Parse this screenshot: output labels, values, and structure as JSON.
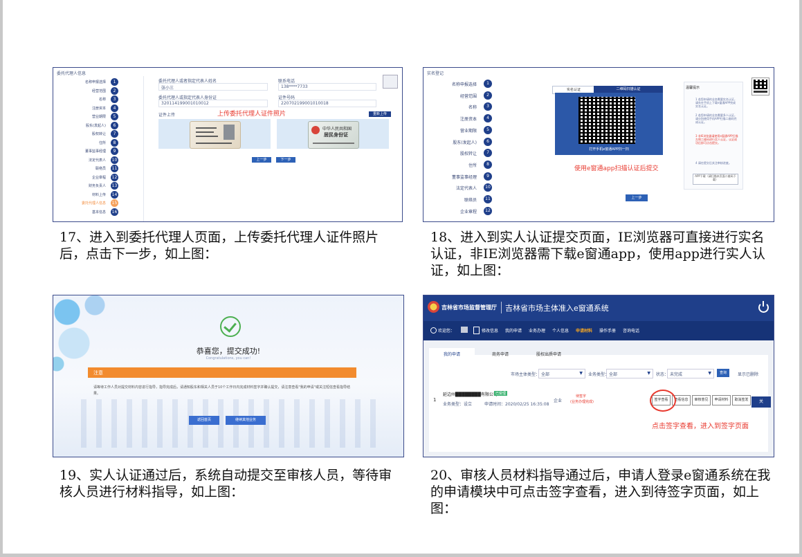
{
  "captions": {
    "c17": "17、进入到委托代理人页面，上传委托代理人证件照片后，点击下一步，如上图：",
    "c18": "18、进入到实人认证提交页面，IE浏览器可直接进行实名认证，非IE浏览器需下载e窗通app，使用app进行实人认证，如上图：",
    "c19": "19、实人认证通过后，系统自动提交至审核人员，等待审核人员进行材料指导，如上图：",
    "c20": "20、审核人员材料指导通过后，申请人登录e窗通系统在我的申请模块中可点击签字查看，进入到待签字页面，如上图："
  },
  "s17": {
    "header": "委托代理人信息",
    "steps": [
      "名称申报选择",
      "经营范围",
      "名称",
      "注册资本",
      "营业期限",
      "股东(发起人)",
      "股权转让",
      "住所",
      "董事监事经理",
      "法定代表人",
      "联络员",
      "企业章程",
      "财务负责人",
      "材料上传",
      "委托代理人信息",
      "基本信息"
    ],
    "step_numbers": [
      "1",
      "2",
      "3",
      "4",
      "5",
      "6",
      "7",
      "8",
      "9",
      "10",
      "11",
      "12",
      "13",
      "14",
      "15",
      "16"
    ],
    "field1_label": "委托代理人或者指定代表人姓名",
    "field1_value": "张小三",
    "field2_label": "委托代理人或指定代表人身份证",
    "field2_value": "320114199001010012",
    "field3_label": "联系电话",
    "field3_value": "138****7733",
    "field4_label": "证件号码",
    "field4_value": "220702199001010018",
    "upload_label": "证件上传",
    "upload_note": "上传委托代理人证件照片",
    "small_btn": "重新上传",
    "id_front_title": "",
    "id_back_title1": "中华人民共和国",
    "id_back_title2": "居民身份证",
    "prev_btn": "上一步",
    "next_btn": "下一步"
  },
  "s18": {
    "header": "实名登记",
    "steps": [
      "名称申报选择",
      "经营范围",
      "名称",
      "注册资本",
      "营业期限",
      "股东(发起人)",
      "股权转让",
      "住所",
      "董事监事经理",
      "法定代表人",
      "联络员",
      "企业章程"
    ],
    "step_numbers": [
      "1",
      "2",
      "3",
      "4",
      "5",
      "6",
      "7",
      "8",
      "9",
      "10",
      "11",
      "12"
    ],
    "tab1": "实名认证",
    "tab2": "二维码扫描认证",
    "qr_caption": "打开手机e窗通APP扫一扫",
    "note": "使用e窗通app扫描认证后提交",
    "prev_btn": "上一步",
    "tips_title": "温馨提示",
    "tips": [
      "1 若您申请的业务需要实名认证，请先在手机上下载e窗通APP完成实名认证。",
      "2 若您申请的业务需要多人认证，请分别使用手机APP扫描二维码完成认证。",
      "3 非IE浏览器请使用e窗通APP扫描左侧二维码进行实人认证，认证成功后即可点击提交。",
      "4 请在提交后关注审核进度。"
    ],
    "app_btn": "APP下载（请扫描本页面二维码下载）"
  },
  "s19": {
    "title": "恭喜您，提交成功!",
    "subtitle": "Congratulations, you can!",
    "banner": "注意",
    "body": "请等待工作人员对提交材料内容进行指导，指导完成后，请通知股东和相关人员于10个工作日内完成材料签字并确认提交，请注意查看\"我的申请\"或关注短信查看指导结果。",
    "btn1": "返回首页",
    "btn2": "继续其他业务"
  },
  "s20": {
    "org": "吉林省市场监督管理厅",
    "system": "吉林省市场主体准入e窗通系统",
    "welcome": "欢迎您：",
    "nav": [
      "修改信息",
      "我的申请",
      "业务办理",
      "个人信息",
      "申请材料",
      "操作手册",
      "咨询电话"
    ],
    "tabs": [
      "我的申请",
      "商务申请",
      "股权出质申请"
    ],
    "filter1_label": "市场主体类型：",
    "filter1_value": "全部",
    "filter2_label": "业务类型：",
    "filter2_value": "全部",
    "filter3_label": "状态：",
    "filter3_value": "未完成",
    "search_btn": "查询",
    "refresh": "显示已删除",
    "row_index": "1",
    "row_company": "延边州████████有限公司",
    "row_tag": "已受理",
    "row_type": "业务类型：设立",
    "row_date": "申请时间：2020/02/25 16:35:08",
    "row_kind": "企业",
    "row_status1": "待签字",
    "row_status2": "(业务办理完成)",
    "actions": [
      "签字查看",
      "查看信息",
      "审核意见",
      "申请材料",
      "取消签发"
    ],
    "extra_btn": "关",
    "annotation": "点击签字查看，进入到签字页面"
  }
}
